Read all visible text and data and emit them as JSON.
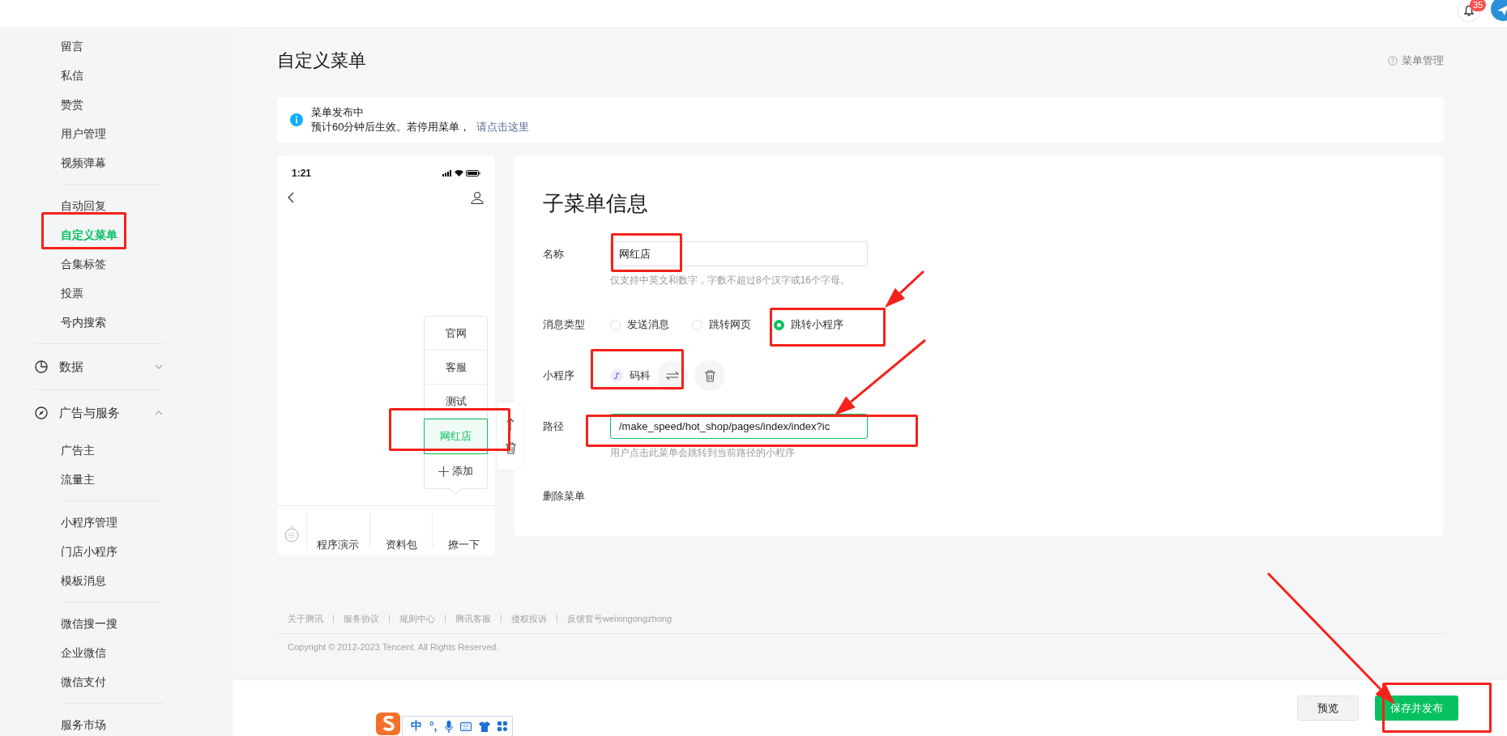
{
  "top_bar": {
    "notification_badge": "35"
  },
  "sidebar": {
    "sections": [
      {
        "kind": "group",
        "items": [
          {
            "label": "留言",
            "selected": false
          },
          {
            "label": "私信",
            "selected": false
          },
          {
            "label": "赞赏",
            "selected": false
          },
          {
            "label": "用户管理",
            "selected": false
          },
          {
            "label": "视频弹幕",
            "selected": false
          }
        ]
      },
      {
        "kind": "group",
        "items": [
          {
            "label": "自动回复",
            "selected": false
          },
          {
            "label": "自定义菜单",
            "selected": true
          },
          {
            "label": "合集标签",
            "selected": false
          },
          {
            "label": "投票",
            "selected": false
          },
          {
            "label": "号内搜索",
            "selected": false
          }
        ]
      },
      {
        "kind": "header",
        "label": "数据",
        "expanded": false
      },
      {
        "kind": "header",
        "label": "广告与服务",
        "expanded": true
      },
      {
        "kind": "group",
        "items": [
          {
            "label": "广告主",
            "selected": false
          },
          {
            "label": "流量主",
            "selected": false
          }
        ]
      },
      {
        "kind": "group",
        "items": [
          {
            "label": "小程序管理",
            "selected": false
          },
          {
            "label": "门店小程序",
            "selected": false
          },
          {
            "label": "模板消息",
            "selected": false
          }
        ]
      },
      {
        "kind": "group",
        "items": [
          {
            "label": "微信搜一搜",
            "selected": false
          },
          {
            "label": "企业微信",
            "selected": false
          },
          {
            "label": "微信支付",
            "selected": false
          }
        ]
      },
      {
        "kind": "group",
        "items": [
          {
            "label": "服务市场",
            "selected": false
          }
        ]
      }
    ]
  },
  "page": {
    "title": "自定义菜单",
    "help_link": "菜单管理"
  },
  "notice": {
    "title": "菜单发布中",
    "text": "预计60分钟后生效。若停用菜单，",
    "link": "请点击这里"
  },
  "phone": {
    "time": "1:21",
    "submenu": [
      {
        "label": "官网",
        "selected": false
      },
      {
        "label": "客服",
        "selected": false
      },
      {
        "label": "测试",
        "selected": false
      },
      {
        "label": "网红店",
        "selected": true
      }
    ],
    "add_label": "添加",
    "menu": [
      "程序演示",
      "资料包",
      "撩一下"
    ]
  },
  "form": {
    "title": "子菜单信息",
    "name": {
      "label": "名称",
      "value": "网红店",
      "hint": "仅支持中英文和数字，字数不超过8个汉字或16个字母。"
    },
    "message_type": {
      "label": "消息类型",
      "options": [
        {
          "label": "发送消息",
          "selected": false
        },
        {
          "label": "跳转网页",
          "selected": false
        },
        {
          "label": "跳转小程序",
          "selected": true
        }
      ]
    },
    "mini_program": {
      "label": "小程序",
      "name": "码科"
    },
    "path": {
      "label": "路径",
      "value": "/make_speed/hot_shop/pages/index/index?ic",
      "hint": "用户点击此菜单会跳转到当前路径的小程序"
    },
    "delete_link": "删除菜单"
  },
  "footer": {
    "links": [
      "关于腾讯",
      "服务协议",
      "规则中心",
      "腾讯客服",
      "侵权投诉",
      "反馈官号weixingongzhong"
    ],
    "copyright": "Copyright © 2012-2023 Tencent. All Rights Reserved."
  },
  "actions": {
    "buttons": [
      {
        "label": "预览",
        "kind": "secondary"
      },
      {
        "label": "保存并发布",
        "kind": "primary"
      }
    ]
  },
  "ime_toolbar": {
    "mode": "中",
    "punctuation": "°,"
  }
}
